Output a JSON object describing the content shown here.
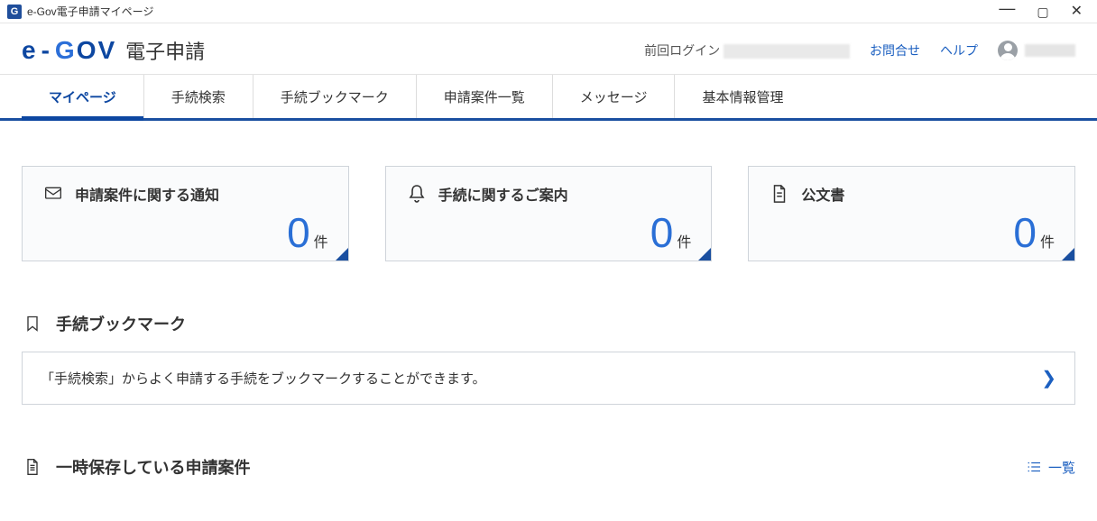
{
  "window": {
    "title": "e-Gov電子申請マイページ"
  },
  "brand": {
    "app_title": "電子申請"
  },
  "header": {
    "prev_login_label": "前回ログイン",
    "inquiry": "お問合せ",
    "help": "ヘルプ"
  },
  "nav": {
    "items": [
      {
        "label": "マイページ"
      },
      {
        "label": "手続検索"
      },
      {
        "label": "手続ブックマーク"
      },
      {
        "label": "申請案件一覧"
      },
      {
        "label": "メッセージ"
      },
      {
        "label": "基本情報管理"
      }
    ]
  },
  "cards": {
    "notice": {
      "title": "申請案件に関する通知",
      "count": "0",
      "unit": "件"
    },
    "guide": {
      "title": "手続に関するご案内",
      "count": "0",
      "unit": "件"
    },
    "doc": {
      "title": "公文書",
      "count": "0",
      "unit": "件"
    }
  },
  "sections": {
    "bookmark": {
      "title": "手続ブックマーク",
      "info": "「手続検索」からよく申請する手続をブックマークすることができます。"
    },
    "draft": {
      "title": "一時保存している申請案件",
      "list_link": "一覧"
    }
  }
}
